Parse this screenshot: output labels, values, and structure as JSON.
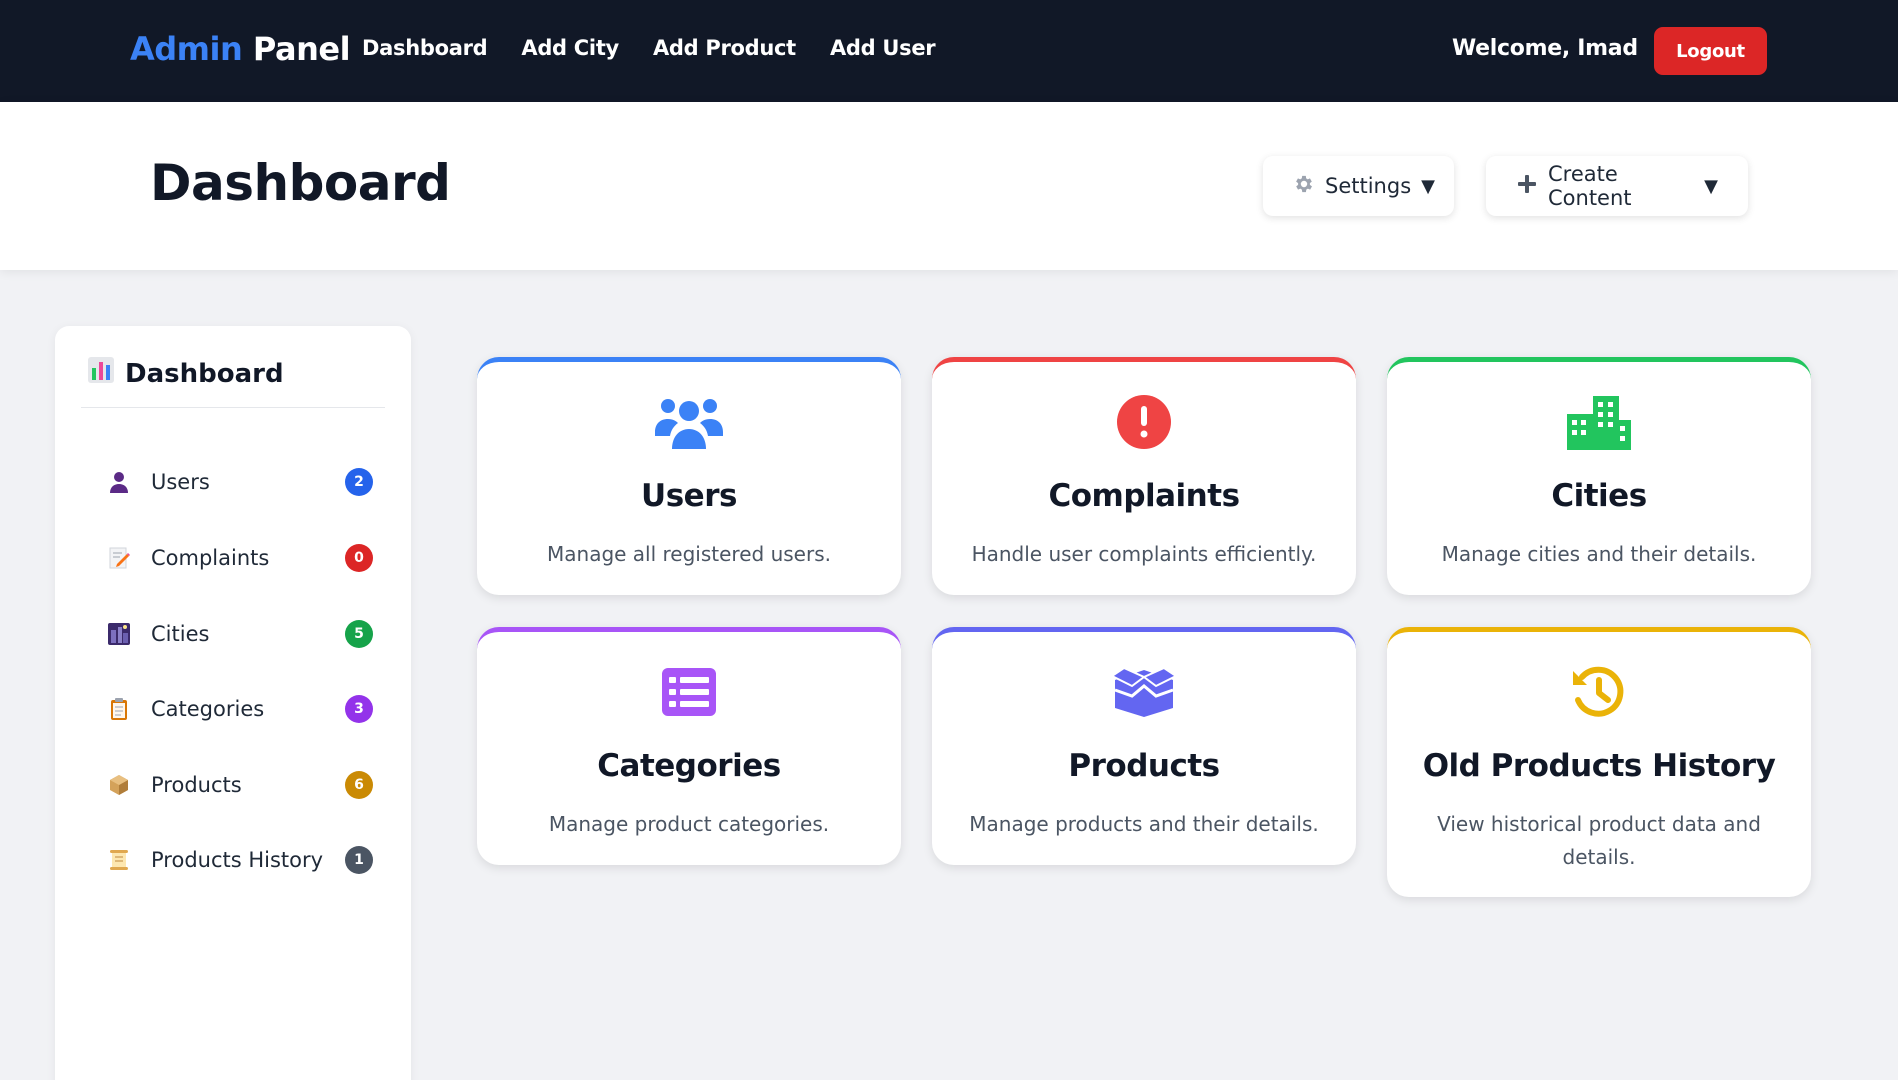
{
  "navbar": {
    "brand_part1": "Admin",
    "brand_part2": "Panel",
    "links": [
      "Dashboard",
      "Add City",
      "Add Product",
      "Add User"
    ],
    "welcome": "Welcome, Imad",
    "logout": "Logout"
  },
  "header": {
    "title": "Dashboard",
    "settings_label": "Settings",
    "create_label": "Create Content",
    "caret": "▼"
  },
  "sidebar": {
    "title": "Dashboard",
    "items": [
      {
        "label": "Users",
        "count": "2",
        "icon": "user-icon",
        "badge_color": "#2563eb"
      },
      {
        "label": "Complaints",
        "count": "0",
        "icon": "memo-icon",
        "badge_color": "#dc2626"
      },
      {
        "label": "Cities",
        "count": "5",
        "icon": "cityscape-icon",
        "badge_color": "#16a34a"
      },
      {
        "label": "Categories",
        "count": "3",
        "icon": "clipboard-icon",
        "badge_color": "#9333ea"
      },
      {
        "label": "Products",
        "count": "6",
        "icon": "package-icon",
        "badge_color": "#ca8a04"
      },
      {
        "label": "Products History",
        "count": "1",
        "icon": "scroll-icon",
        "badge_color": "#4b5563"
      }
    ]
  },
  "cards": [
    {
      "title": "Users",
      "desc": "Manage all registered users.",
      "icon": "users-icon",
      "color": "#3b82f6"
    },
    {
      "title": "Complaints",
      "desc": "Handle user complaints efficiently.",
      "icon": "exclamation-circle-icon",
      "color": "#ef4444"
    },
    {
      "title": "Cities",
      "desc": "Manage cities and their details.",
      "icon": "city-icon",
      "color": "#22c55e"
    },
    {
      "title": "Categories",
      "desc": "Manage product categories.",
      "icon": "list-icon",
      "color": "#a855f7"
    },
    {
      "title": "Products",
      "desc": "Manage products and their details.",
      "icon": "box-open-icon",
      "color": "#6366f1"
    },
    {
      "title": "Old Products History",
      "desc": "View historical product data and details.",
      "icon": "history-icon",
      "color": "#eab308"
    }
  ]
}
